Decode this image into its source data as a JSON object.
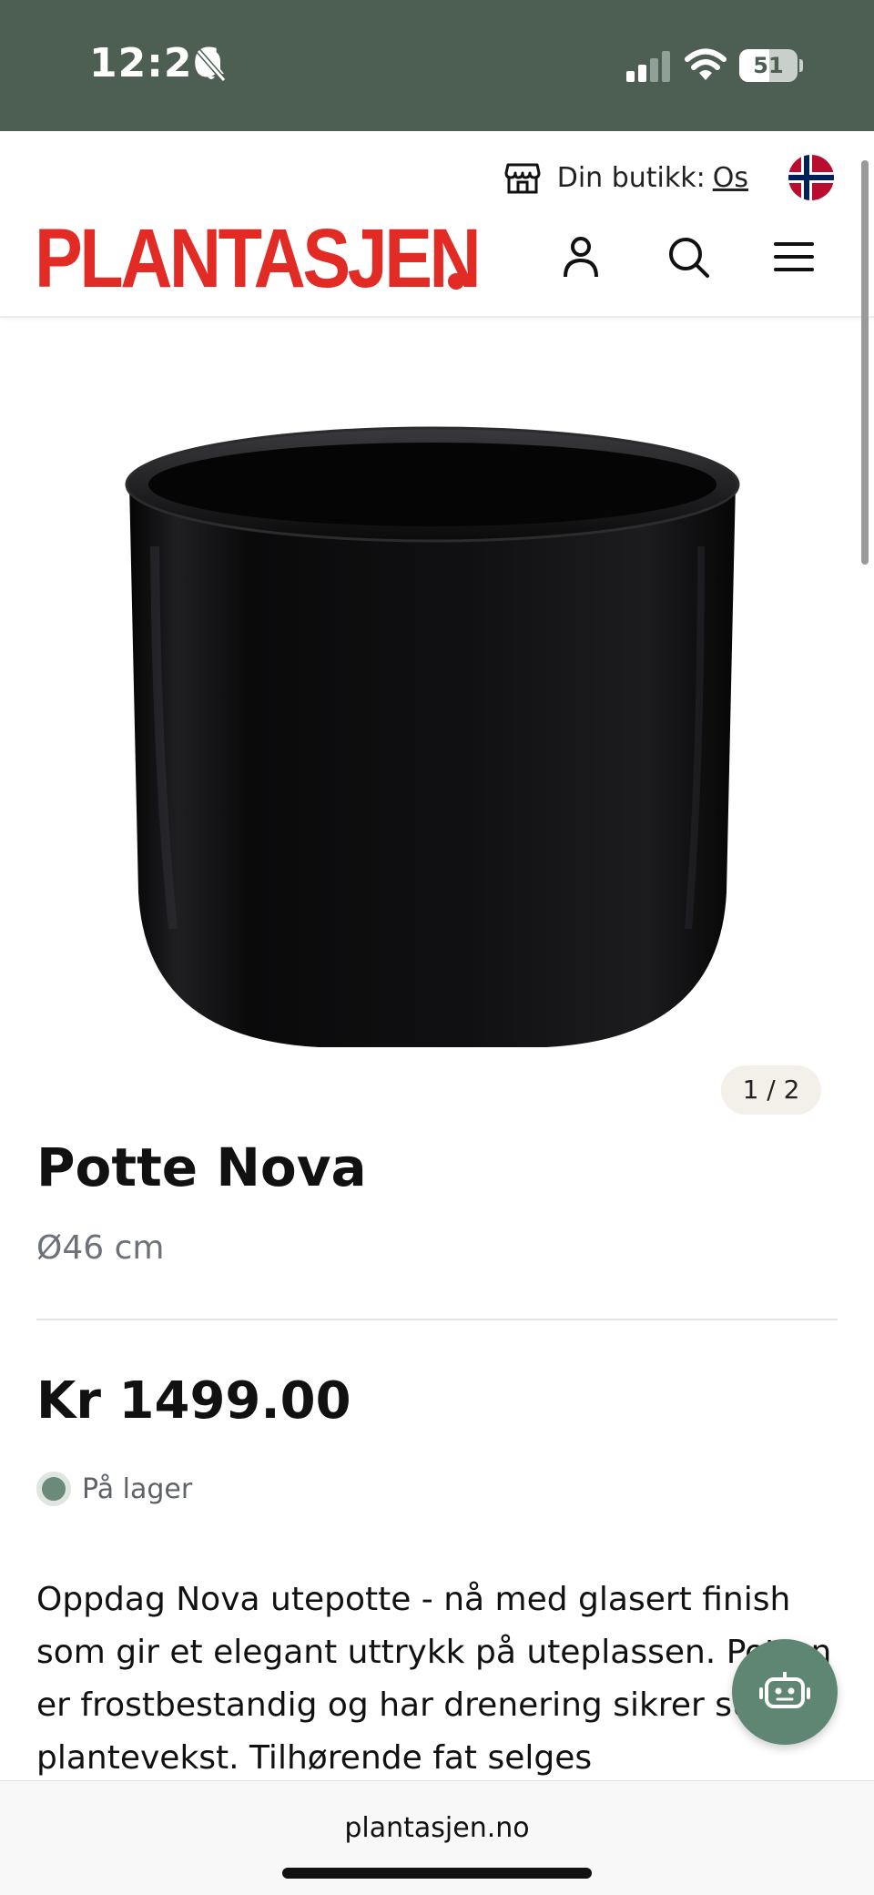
{
  "status_bar": {
    "time": "12:26",
    "battery": "51",
    "battery_level": 0.51,
    "background": "#4d5f53"
  },
  "header": {
    "store_label": "Din butikk:",
    "store_name": "Os",
    "logo_text": "PLANTASJEN",
    "brand_color": "#e32b26",
    "icons": [
      "store-icon",
      "norway-flag",
      "account-icon",
      "search-icon",
      "menu-icon"
    ]
  },
  "gallery": {
    "counter": "1 / 2"
  },
  "product": {
    "title": "Potte Nova",
    "subtitle": "Ø46 cm",
    "price": "Kr 1499.00",
    "stock": "På lager",
    "description": "Oppdag Nova utepotte - nå med glasert finish som gir et elegant uttrykk på uteplassen. Potten er frostbestandig og har drenering sikrer sunn plantevekst. Tilhørende fat selges"
  },
  "chat": {
    "icon": "chatbot-icon",
    "color": "#5e8672"
  },
  "browser": {
    "url": "plantasjen.no"
  }
}
